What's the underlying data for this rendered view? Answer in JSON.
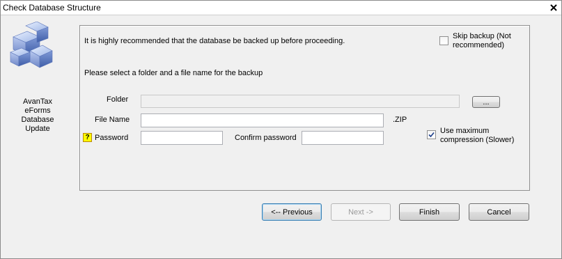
{
  "window": {
    "title": "Check Database Structure"
  },
  "sidebar": {
    "product_label": [
      "AvanTax",
      "eForms",
      "Database",
      "Update"
    ]
  },
  "panel": {
    "recommend_text": "It is highly recommended that the database be backed up before proceeding.",
    "select_text": "Please select a folder and a file name for the backup",
    "skip_backup": {
      "label_line1": "Skip backup (Not",
      "label_line2": "recommended)",
      "checked": false
    },
    "folder": {
      "label": "Folder",
      "value": "",
      "browse_label": "..."
    },
    "file_name": {
      "label": "File Name",
      "value": "",
      "extension": ".ZIP"
    },
    "password": {
      "help": "?",
      "label": "Password",
      "value": ""
    },
    "confirm_password": {
      "label": "Confirm password",
      "value": ""
    },
    "max_compression": {
      "label_line1": "Use maximum",
      "label_line2": "compression (Slower)",
      "checked": true
    }
  },
  "buttons": {
    "previous": "<-- Previous",
    "next": "Next ->",
    "finish": "Finish",
    "cancel": "Cancel"
  }
}
